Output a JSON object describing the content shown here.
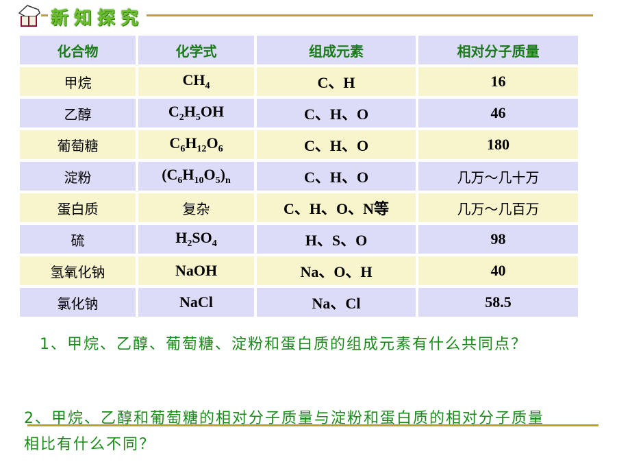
{
  "header": {
    "title": "新知探究",
    "icon": "book-icon"
  },
  "table": {
    "columns": [
      "化合物",
      "化学式",
      "组成元素",
      "相对分子质量"
    ],
    "rows": [
      {
        "compound": "甲烷",
        "formula": [
          [
            "CH",
            ""
          ],
          [
            "4",
            "sub"
          ]
        ],
        "elements": "C、H",
        "mass": "16"
      },
      {
        "compound": "乙醇",
        "formula": [
          [
            "C",
            ""
          ],
          [
            "2",
            "sub"
          ],
          [
            "H",
            ""
          ],
          [
            "5",
            "sub"
          ],
          [
            "OH",
            ""
          ]
        ],
        "elements": "C、H、O",
        "mass": "46"
      },
      {
        "compound": "葡萄糖",
        "formula": [
          [
            "C",
            ""
          ],
          [
            "6",
            "sub"
          ],
          [
            "H",
            ""
          ],
          [
            "12",
            "sub"
          ],
          [
            "O",
            ""
          ],
          [
            "6",
            "sub"
          ]
        ],
        "elements": "C、H、O",
        "mass": "180"
      },
      {
        "compound": "淀粉",
        "formula": [
          [
            "(C",
            ""
          ],
          [
            "6",
            "sub"
          ],
          [
            "H",
            ""
          ],
          [
            "10",
            "sub"
          ],
          [
            "O",
            ""
          ],
          [
            "5",
            "sub"
          ],
          [
            ")",
            ""
          ],
          [
            "n",
            "sub"
          ]
        ],
        "elements": "C、H、O",
        "mass": "几万～几十万"
      },
      {
        "compound": "蛋白质",
        "formula": [
          [
            "复杂",
            "cn"
          ]
        ],
        "elements": "C、H、O、N等",
        "mass": "几万～几百万"
      },
      {
        "compound": "硫",
        "formula": [
          [
            "H",
            ""
          ],
          [
            "2",
            "sub"
          ],
          [
            "SO",
            ""
          ],
          [
            "4",
            "sub"
          ]
        ],
        "elements": "H、S、O",
        "mass": "98"
      },
      {
        "compound": "氢氧化钠",
        "formula": [
          [
            "NaOH",
            ""
          ]
        ],
        "elements": "Na、O、H",
        "mass": "40"
      },
      {
        "compound": "氯化钠",
        "formula": [
          [
            "NaCl",
            ""
          ]
        ],
        "elements": "Na、Cl",
        "mass": "58.5"
      }
    ]
  },
  "questions": [
    "1、甲烷、乙醇、葡萄糖、淀粉和蛋白质的组成元素有什么共同点？",
    "2、甲烷、乙醇和葡萄糖的相对分子质量与淀粉和蛋白质的相对分子质量相比有什么不同？"
  ],
  "colors": {
    "header_bg": "#dcdcf8",
    "row_alt_bg": "#f8f4cc",
    "accent_line": "#c0a028",
    "green_text": "#1a8a1a"
  }
}
